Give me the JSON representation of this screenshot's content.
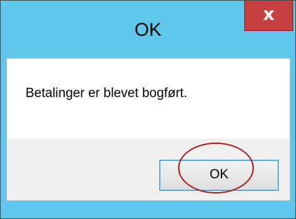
{
  "window": {
    "title": "OK",
    "close_label": "x",
    "message": "Betalinger er blevet bogført.",
    "ok_label": "OK"
  },
  "colors": {
    "frame": "#5fc7ec",
    "close_button": "#c64040",
    "button_area": "#f0f0f0",
    "button_border": "#2d8bd2",
    "annotation": "#b01c1c"
  },
  "icons": {
    "close": "close-icon"
  }
}
